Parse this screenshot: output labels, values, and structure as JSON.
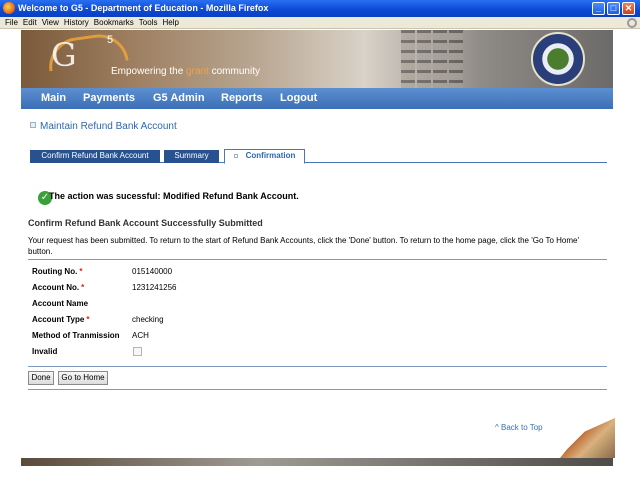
{
  "window": {
    "title": "Welcome to G5 - Department of Education - Mozilla Firefox",
    "controls": {
      "minimize": "_",
      "maximize": "□",
      "close": "✕"
    }
  },
  "menubar": [
    "File",
    "Edit",
    "View",
    "History",
    "Bookmarks",
    "Tools",
    "Help"
  ],
  "banner": {
    "logo_letter": "G",
    "logo_number": "5",
    "tagline_prefix": "Empowering the ",
    "tagline_highlight": "grant",
    "tagline_suffix": " community"
  },
  "nav": [
    "Main",
    "Payments",
    "G5 Admin",
    "Reports",
    "Logout"
  ],
  "page_title": "Maintain Refund Bank Account",
  "tabs": [
    {
      "label": "Confirm Refund Bank Account",
      "active": false
    },
    {
      "label": "Summary",
      "active": false
    },
    {
      "label": "Confirmation",
      "active": true
    }
  ],
  "success_message": "The action was sucessful: Modified Refund Bank Account.",
  "section_title": "Confirm Refund Bank Account Successfully Submitted",
  "intro_text": "Your request has been submitted. To return to the start of Refund Bank Accounts, click the 'Done' button. To return to the home page, click the 'Go To Home' button.",
  "fields": [
    {
      "label": "Routing No.",
      "required": true,
      "value": "015140000"
    },
    {
      "label": "Account No.",
      "required": true,
      "value": "1231241256"
    },
    {
      "label": "Account Name",
      "required": false,
      "value": ""
    },
    {
      "label": "Account Type",
      "required": true,
      "value": "checking"
    },
    {
      "label": "Method of Tranmission",
      "required": false,
      "value": "ACH"
    },
    {
      "label": "Invalid",
      "required": false,
      "value": ""
    }
  ],
  "required_marker": "*",
  "invalid_checked": false,
  "buttons": {
    "done": "Done",
    "go_home": "Go to Home"
  },
  "back_to_top": "^ Back to Top",
  "colors": {
    "nav": "#3b6fb6",
    "tab": "#27518f",
    "link": "#2d67b0",
    "required": "#d62020"
  }
}
